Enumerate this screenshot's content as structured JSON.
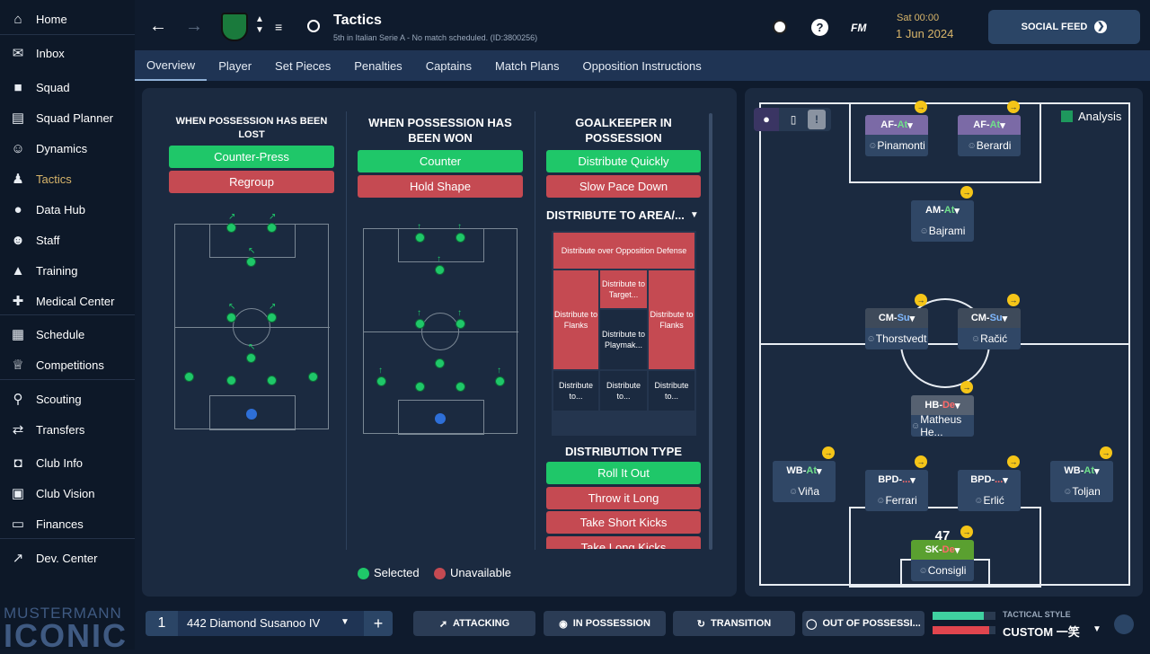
{
  "sidebar": {
    "items": [
      {
        "label": "Home",
        "icon": "home-icon"
      },
      {
        "label": "Inbox",
        "icon": "inbox-icon"
      },
      {
        "label": "Squad",
        "icon": "shirt-icon"
      },
      {
        "label": "Squad Planner",
        "icon": "clipboard-icon"
      },
      {
        "label": "Dynamics",
        "icon": "people-icon"
      },
      {
        "label": "Tactics",
        "icon": "tactics-icon"
      },
      {
        "label": "Data Hub",
        "icon": "data-hub-icon"
      },
      {
        "label": "Staff",
        "icon": "staff-icon"
      },
      {
        "label": "Training",
        "icon": "training-icon"
      },
      {
        "label": "Medical Center",
        "icon": "medical-icon"
      },
      {
        "label": "Schedule",
        "icon": "calendar-icon"
      },
      {
        "label": "Competitions",
        "icon": "trophy-icon"
      },
      {
        "label": "Scouting",
        "icon": "search-icon"
      },
      {
        "label": "Transfers",
        "icon": "transfer-icon"
      },
      {
        "label": "Club Info",
        "icon": "shield-icon"
      },
      {
        "label": "Club Vision",
        "icon": "briefcase-icon"
      },
      {
        "label": "Finances",
        "icon": "money-icon"
      },
      {
        "label": "Dev. Center",
        "icon": "dev-center-icon"
      }
    ],
    "brand_line1": "MUSTERMANN",
    "brand_line2": "ICONIC"
  },
  "header": {
    "title": "Tactics",
    "subtitle": "5th in Italian Serie A - No match scheduled. (ID:3800256)",
    "fm_label": "FM",
    "day": "Sat 00:00",
    "date": "1 Jun 2024",
    "social_feed": "SOCIAL FEED"
  },
  "tabs": [
    "Overview",
    "Player",
    "Set Pieces",
    "Penalties",
    "Captains",
    "Match Plans",
    "Opposition Instructions"
  ],
  "instructions": {
    "lost": {
      "title": "WHEN POSSESSION HAS BEEN LOST",
      "options": [
        "Counter-Press",
        "Regroup"
      ]
    },
    "won": {
      "title": "WHEN POSSESSION HAS BEEN WON",
      "options": [
        "Counter",
        "Hold Shape"
      ]
    },
    "gk": {
      "title": "GOALKEEPER IN POSSESSION",
      "options": [
        "Distribute Quickly",
        "Slow Pace Down"
      ]
    },
    "distribute_area": "DISTRIBUTE TO AREA/...",
    "zones": {
      "opposition_defense": "Distribute over Opposition Defense",
      "target": "Distribute to Target...",
      "flanks_left": "Distribute to Flanks",
      "flanks_right": "Distribute to Flanks",
      "playmaker": "Distribute to Playmak...",
      "bottom": [
        "Distribute to...",
        "Distribute to...",
        "Distribute to..."
      ]
    },
    "distribution_type": "DISTRIBUTION TYPE",
    "distribution_options": [
      "Roll It Out",
      "Throw it Long",
      "Take Short Kicks",
      "Take Long Kicks"
    ],
    "legend": {
      "selected": "Selected",
      "unavailable": "Unavailable"
    }
  },
  "formation_panel": {
    "analysis": "Analysis",
    "players": [
      {
        "role": "AF",
        "duty": "At",
        "name": "Pinamonti"
      },
      {
        "role": "AF",
        "duty": "At",
        "name": "Berardi"
      },
      {
        "role": "AM",
        "duty": "At",
        "name": "Bajrami"
      },
      {
        "role": "CM",
        "duty": "Su",
        "name": "Thorstvedt"
      },
      {
        "role": "CM",
        "duty": "Su",
        "name": "Račić"
      },
      {
        "role": "HB",
        "duty": "De",
        "name": "Matheus He..."
      },
      {
        "role": "WB",
        "duty": "At",
        "name": "Viña"
      },
      {
        "role": "BPD",
        "duty": "...",
        "name": "Ferrari"
      },
      {
        "role": "BPD",
        "duty": "...",
        "name": "Erlić"
      },
      {
        "role": "WB",
        "duty": "At",
        "name": "Toljan"
      },
      {
        "role": "SK",
        "duty": "De",
        "name": "Consigli"
      }
    ],
    "gk_number": "47"
  },
  "bottom": {
    "slot": "1",
    "tactic_name": "442 Diamond Susanoo IV",
    "add": "+",
    "phases": [
      "ATTACKING",
      "IN POSSESSION",
      "TRANSITION",
      "OUT OF POSSESSI..."
    ],
    "style_label": "TACTICAL STYLE",
    "style_value": "CUSTOM 一笑"
  },
  "colors": {
    "selected": "#1fc769",
    "unavailable": "#c54a52",
    "accent": "#d8b56a"
  }
}
